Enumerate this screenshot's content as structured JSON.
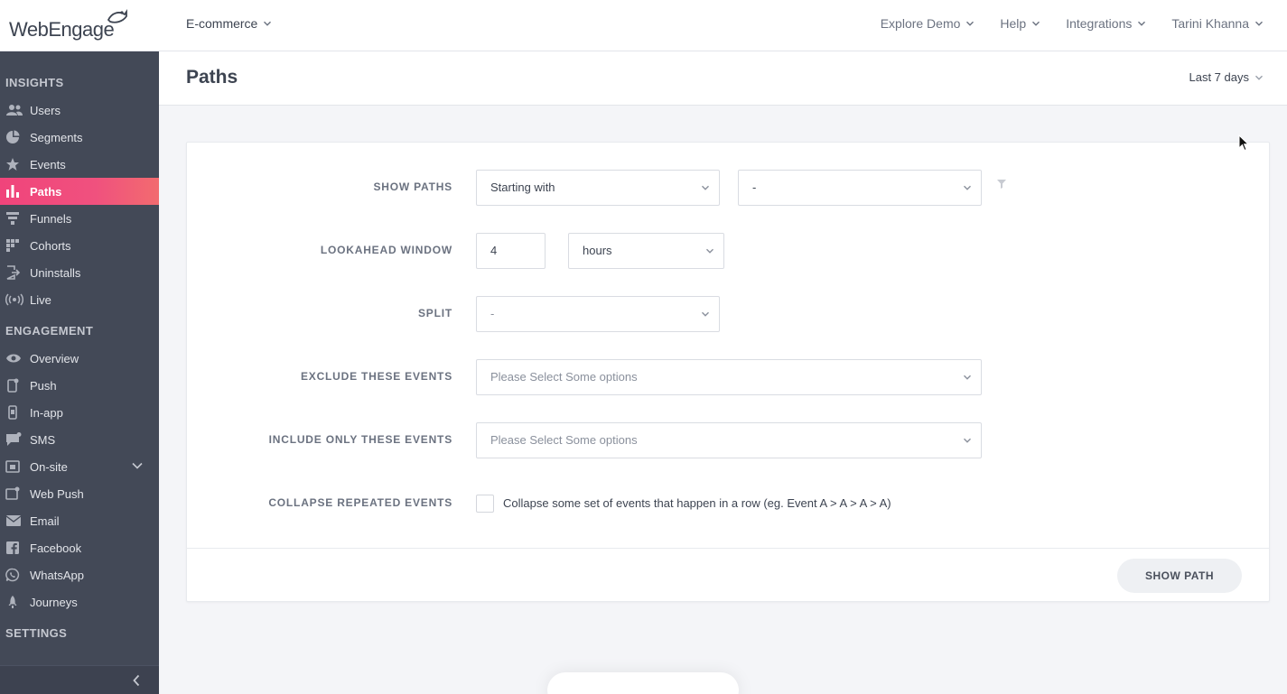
{
  "brand": {
    "logo": "WebEngage"
  },
  "header": {
    "project": "E-commerce",
    "nav": [
      "Explore Demo",
      "Help",
      "Integrations",
      "Tarini Khanna"
    ]
  },
  "sidebar": {
    "sections": [
      {
        "title": "INSIGHTS",
        "items": [
          {
            "label": "Users",
            "icon": "users-icon"
          },
          {
            "label": "Segments",
            "icon": "pie-icon"
          },
          {
            "label": "Events",
            "icon": "star-icon"
          },
          {
            "label": "Paths",
            "icon": "bar-chart-icon",
            "active": true
          },
          {
            "label": "Funnels",
            "icon": "funnel-icon"
          },
          {
            "label": "Cohorts",
            "icon": "grid-icon"
          },
          {
            "label": "Uninstalls",
            "icon": "exit-icon"
          },
          {
            "label": "Live",
            "icon": "broadcast-icon"
          }
        ]
      },
      {
        "title": "ENGAGEMENT",
        "items": [
          {
            "label": "Overview",
            "icon": "eye-icon"
          },
          {
            "label": "Push",
            "icon": "phone-icon"
          },
          {
            "label": "In-app",
            "icon": "mobile-icon"
          },
          {
            "label": "SMS",
            "icon": "chat-icon"
          },
          {
            "label": "On-site",
            "icon": "window-icon",
            "expandable": true
          },
          {
            "label": "Web Push",
            "icon": "browser-icon"
          },
          {
            "label": "Email",
            "icon": "mail-icon"
          },
          {
            "label": "Facebook",
            "icon": "facebook-icon"
          },
          {
            "label": "WhatsApp",
            "icon": "whatsapp-icon"
          },
          {
            "label": "Journeys",
            "icon": "rocket-icon"
          }
        ]
      },
      {
        "title": "SETTINGS",
        "items": []
      }
    ]
  },
  "page": {
    "title": "Paths",
    "date_range": "Last 7 days"
  },
  "form": {
    "show_paths": {
      "label": "SHOW PATHS",
      "mode": "Starting with",
      "event": "-"
    },
    "lookahead": {
      "label": "LOOKAHEAD WINDOW",
      "value": "4",
      "unit": "hours"
    },
    "split": {
      "label": "SPLIT",
      "value": "-"
    },
    "exclude": {
      "label": "EXCLUDE THESE EVENTS",
      "placeholder": "Please Select Some options"
    },
    "include": {
      "label": "INCLUDE ONLY THESE EVENTS",
      "placeholder": "Please Select Some options"
    },
    "collapse": {
      "label": "COLLAPSE REPEATED EVENTS",
      "text": "Collapse some set of events that happen in a row (eg. Event A > A > A > A)",
      "checked": false
    },
    "submit": "SHOW PATH"
  },
  "colors": {
    "sidebar_bg": "#434957",
    "active_start": "#f0447b",
    "active_end": "#f26b6f",
    "page_bg": "#f4f5f8"
  }
}
